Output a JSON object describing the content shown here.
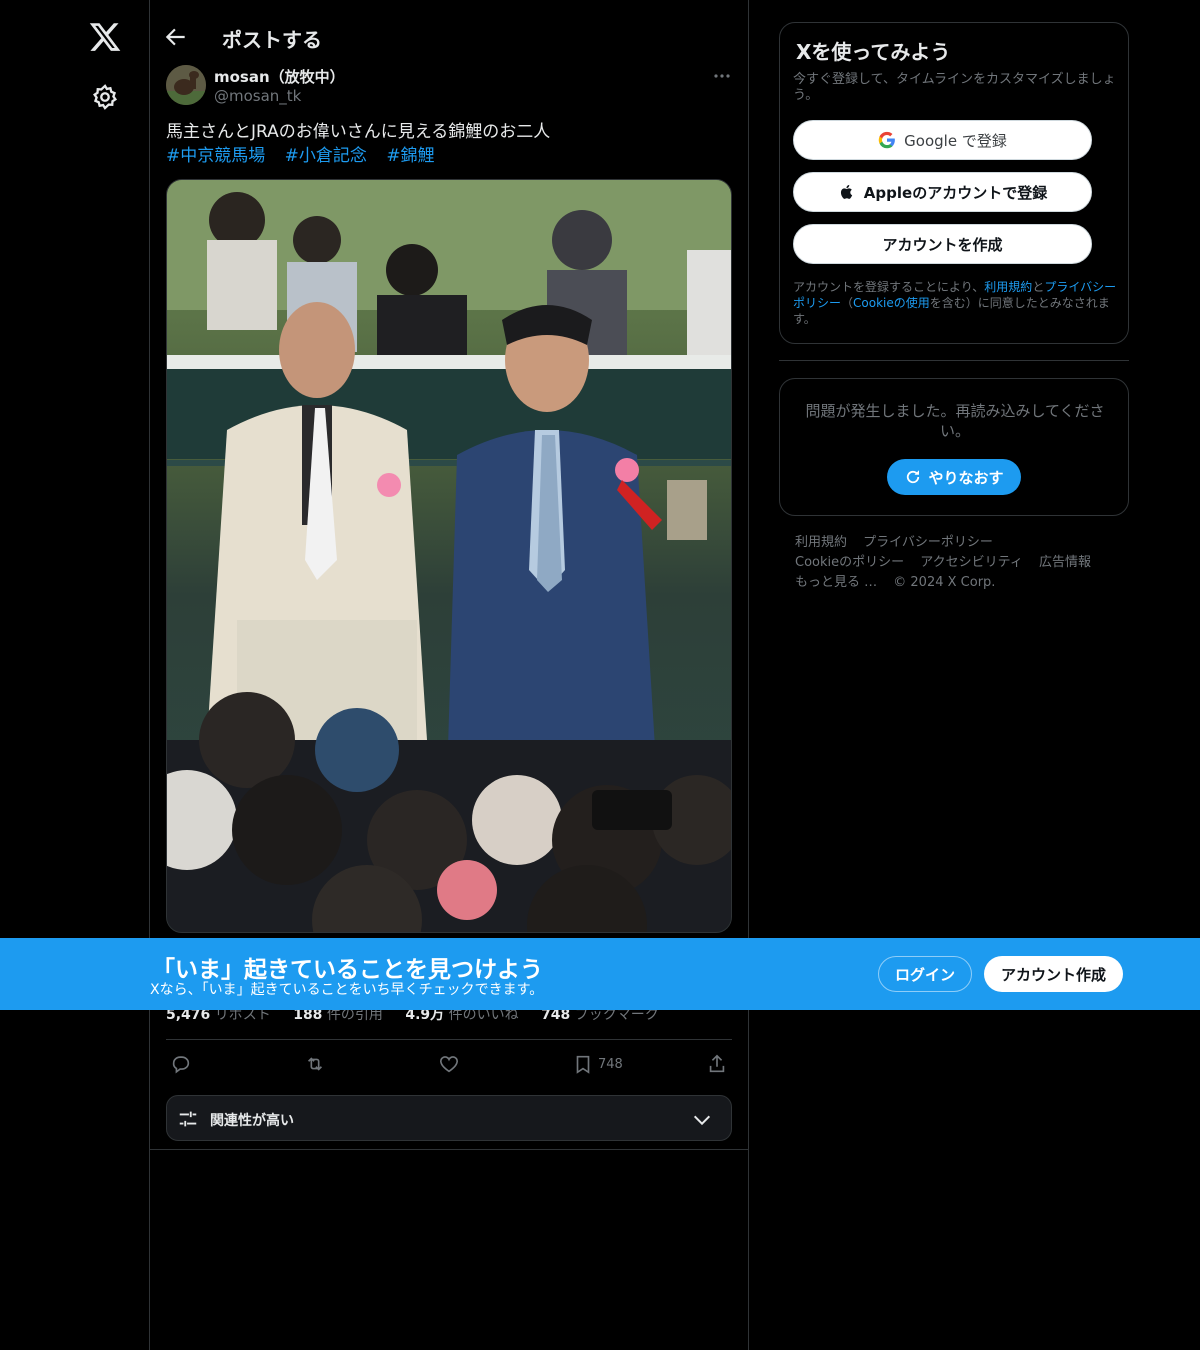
{
  "nav": {
    "logo_icon": "x-logo-icon",
    "settings_icon": "gear-icon"
  },
  "header": {
    "title": "ポストする"
  },
  "tweet": {
    "display_name": "mosan（放牧中）",
    "handle": "@mosan_tk",
    "text": "馬主さんとJRAのお偉いさんに見える錦鯉のお二人",
    "hashtags": [
      "#中京競馬場",
      "#小倉記念",
      "#錦鯉"
    ],
    "stats": {
      "reposts": "5,476",
      "reposts_label": "リポスト",
      "quotes": "188",
      "quotes_label": "件の引用",
      "likes": "4.9万",
      "likes_label": "件のいいね",
      "bookmarks": "748",
      "bookmarks_label": "ブックマーク"
    },
    "bookmark_count": "748"
  },
  "sort": {
    "label": "関連性が高い"
  },
  "signup": {
    "title": "Xを使ってみよう",
    "subtitle": "今すぐ登録して、タイムラインをカスタマイズしましょう。",
    "google_label": "Google で登録",
    "apple_label": "Appleのアカウントで登録",
    "create_label": "アカウントを作成",
    "terms_pre": "アカウントを登録することにより、",
    "terms_link1": "利用規約",
    "terms_and": "と",
    "terms_link2": "プライバシーポリシー",
    "terms_paren_open": "（",
    "terms_link3": "Cookieの使用",
    "terms_post": "を含む）に同意したとみなされます。"
  },
  "error": {
    "message": "問題が発生しました。再読み込みしてください。",
    "retry_label": "やりなおす"
  },
  "footer": {
    "links": [
      "利用規約",
      "プライバシーポリシー",
      "Cookieのポリシー",
      "アクセシビリティ",
      "広告情報",
      "もっと見る …",
      "© 2024 X Corp."
    ]
  },
  "banner": {
    "title": "「いま」起きていることを見つけよう",
    "subtitle": "Xなら、「いま」起きていることをいち早くチェックできます。",
    "login_label": "ログイン",
    "signup_label": "アカウント作成"
  },
  "colors": {
    "accent": "#1d9bf0",
    "background": "#000000",
    "border": "#2f3336",
    "muted_text": "#71767b"
  }
}
